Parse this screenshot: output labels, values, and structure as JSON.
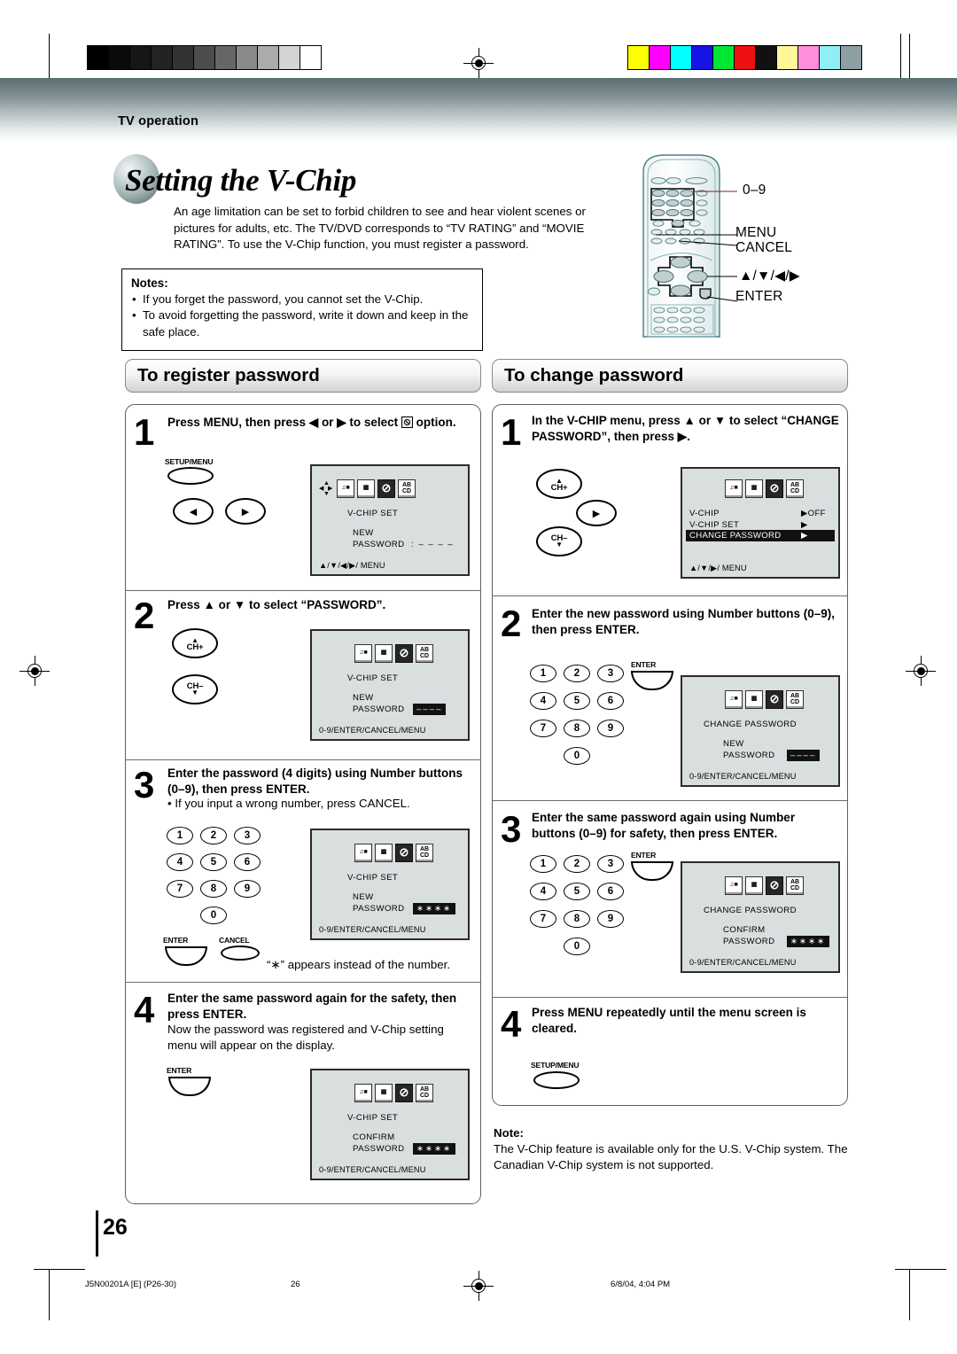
{
  "header": {
    "section_label": "TV operation"
  },
  "title": "Setting the V-Chip",
  "intro": "An age limitation can be set to forbid children to see and hear violent scenes or pictures for adults, etc. The TV/DVD corresponds to “TV RATING” and “MOVIE RATING”. To use the V-Chip function, you must register a password.",
  "notes": {
    "heading": "Notes:",
    "items": [
      "If you forget the password, you cannot set the V-Chip.",
      "To avoid forgetting the password, write it down and keep in the safe place."
    ]
  },
  "remote": {
    "callouts": [
      {
        "label": "0–9"
      },
      {
        "label": "MENU"
      },
      {
        "label": "CANCEL"
      },
      {
        "label": "▲/▼/◀/▶"
      },
      {
        "label": "ENTER"
      }
    ]
  },
  "left_column": {
    "heading": "To register password",
    "steps": [
      {
        "num": "1",
        "text_pre": "Press MENU, then press ◀ or ▶ to select",
        "text_post": "option.",
        "keys": {
          "menu_label": "SETUP/MENU",
          "left_arrow": "◀",
          "right_arrow": "▶"
        },
        "osd": {
          "title": "V-CHIP  SET",
          "line1": "NEW",
          "line2": "PASSWORD",
          "value": ": – – – –",
          "footer": "▲/▼/◀/▶/ MENU",
          "selected_icon_index": 2,
          "has_cursor": true
        }
      },
      {
        "num": "2",
        "text_pre": "Press ▲ or ▼ to select “PASSWORD”.",
        "keys": {
          "ch_up": "CH+",
          "ch_down": "CH–"
        },
        "osd": {
          "title": "V-CHIP  SET",
          "line1": "NEW",
          "line2": "PASSWORD",
          "value": "––––",
          "value_highlighted": true,
          "footer": "0-9/ENTER/CANCEL/MENU",
          "selected_icon_index": 2
        }
      },
      {
        "num": "3",
        "text_pre": "Enter the password (4 digits) using Number buttons (0–9), then press ENTER.",
        "bullet": "• If you input a wrong number, press CANCEL.",
        "caption": "“∗” appears instead of the number.",
        "keys": {
          "numbers": [
            "1",
            "2",
            "3",
            "4",
            "5",
            "6",
            "7",
            "8",
            "9",
            "0"
          ],
          "enter": "ENTER",
          "cancel": "CANCEL"
        },
        "osd": {
          "title": "V-CHIP  SET",
          "line1": "NEW",
          "line2": "PASSWORD",
          "value": "∗∗∗∗",
          "value_highlighted": true,
          "footer": "0-9/ENTER/CANCEL/MENU",
          "selected_icon_index": 2
        }
      },
      {
        "num": "4",
        "text_pre": "Enter the same password again for the safety, then press ENTER.",
        "body": "Now the password was registered and V-Chip setting menu will appear on the display.",
        "keys": {
          "enter": "ENTER"
        },
        "osd": {
          "title": "V-CHIP  SET",
          "line1": "CONFIRM",
          "line2": "PASSWORD",
          "value": "∗∗∗∗",
          "value_highlighted": true,
          "footer": "0-9/ENTER/CANCEL/MENU",
          "selected_icon_index": 2
        }
      }
    ]
  },
  "right_column": {
    "heading": "To change password",
    "steps": [
      {
        "num": "1",
        "text_pre": "In the V-CHIP menu, press ▲ or ▼ to select “CHANGE PASSWORD”, then press ▶.",
        "keys": {
          "ch_up": "CH+",
          "ch_down": "CH–",
          "right_arrow": "▶"
        },
        "osd": {
          "rows": [
            {
              "label": "V-CHIP",
              "value": "▶OFF",
              "selected": false
            },
            {
              "label": "V-CHIP SET",
              "value": "▶",
              "selected": false
            },
            {
              "label": "CHANGE PASSWORD",
              "value": "▶",
              "selected": true
            }
          ],
          "footer": "▲/▼/▶/ MENU",
          "selected_icon_index": 2
        }
      },
      {
        "num": "2",
        "text_pre": "Enter the new password using Number buttons (0–9), then press ENTER.",
        "keys": {
          "numbers": [
            "1",
            "2",
            "3",
            "4",
            "5",
            "6",
            "7",
            "8",
            "9",
            "0"
          ],
          "enter": "ENTER"
        },
        "osd": {
          "title": "CHANGE  PASSWORD",
          "line1": "NEW",
          "line2": "PASSWORD",
          "value": "––––",
          "value_highlighted": true,
          "footer": "0-9/ENTER/CANCEL/MENU",
          "selected_icon_index": 2
        }
      },
      {
        "num": "3",
        "text_pre": "Enter the same password again using Number buttons (0–9) for safety, then press ENTER.",
        "keys": {
          "numbers": [
            "1",
            "2",
            "3",
            "4",
            "5",
            "6",
            "7",
            "8",
            "9",
            "0"
          ],
          "enter": "ENTER"
        },
        "osd": {
          "title": "CHANGE  PASSWORD",
          "line1": "CONFIRM",
          "line2": "PASSWORD",
          "value": "∗∗∗∗",
          "value_highlighted": true,
          "footer": "0-9/ENTER/CANCEL/MENU",
          "selected_icon_index": 2
        }
      },
      {
        "num": "4",
        "text_pre": "Press MENU repeatedly until the menu screen is cleared.",
        "keys": {
          "menu_label": "SETUP/MENU"
        }
      }
    ],
    "note": {
      "heading": "Note:",
      "body": "The V-Chip feature is available only for the U.S. V-Chip system. The Canadian V-Chip system is not supported."
    }
  },
  "footer": {
    "page_number": "26",
    "doc_code": "J5N00201A [E] (P26-30)",
    "page_number_small": "26",
    "timestamp": "6/8/04, 4:04 PM"
  },
  "print_marks": {
    "gray_steps": [
      "#000000",
      "#0b0b0b",
      "#161616",
      "#232323",
      "#333333",
      "#4d4d4d",
      "#666666",
      "#8a8a8a",
      "#ababab",
      "#d4d4d4",
      "#ffffff"
    ],
    "color_patches": [
      "#ffff00",
      "#ff00ff",
      "#00ffff",
      "#1414e6",
      "#00e832",
      "#ee1111",
      "#111111",
      "#fdf79a",
      "#ff8fdc",
      "#8ef0f5",
      "#8d9fa4"
    ]
  }
}
